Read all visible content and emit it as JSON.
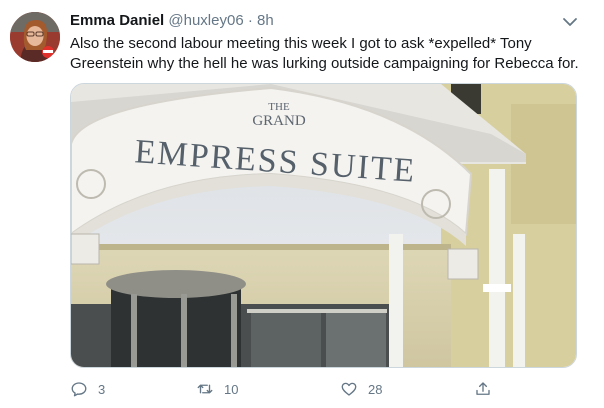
{
  "tweet": {
    "author_name": "Emma Daniel",
    "author_handle": "@huxley06",
    "separator": "·",
    "time": "8h",
    "text": "Also the second labour meeting this week I got to ask *expelled* Tony Greenstein why the hell he was lurking outside campaigning for Rebecca for.",
    "image_sign": {
      "line1": "THE",
      "line2": "GRAND",
      "line3": "EMPRESS SUITE"
    },
    "actions": {
      "reply_count": "3",
      "retweet_count": "10",
      "like_count": "28"
    }
  },
  "colors": {
    "text": "#14171a",
    "secondary": "#657786",
    "border": "#ccd6dd"
  },
  "icons": [
    "reply-icon",
    "retweet-icon",
    "like-icon",
    "share-icon",
    "chevron-down-icon"
  ]
}
